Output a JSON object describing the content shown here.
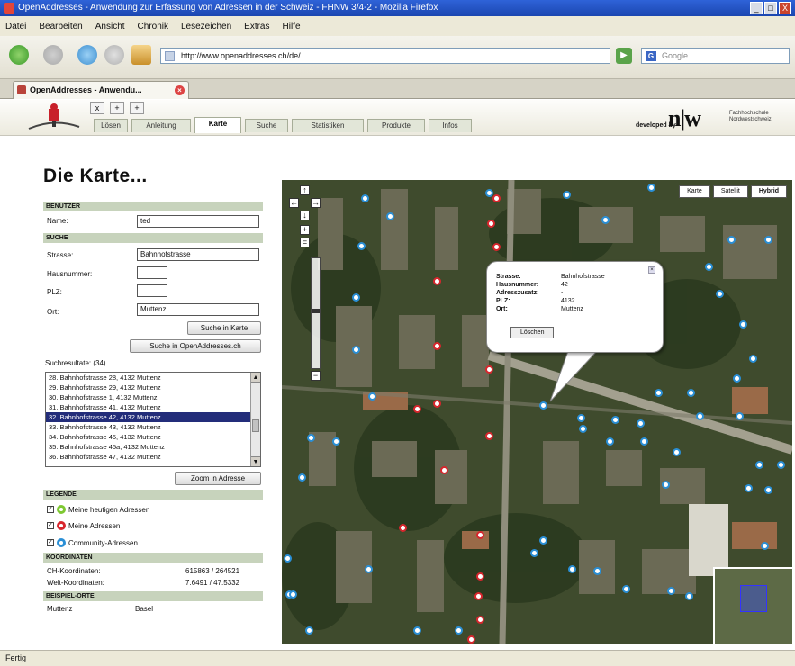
{
  "window": {
    "title": "OpenAddresses - Anwendung zur Erfassung von Adressen in der Schweiz - FHNW 3/4-2 - Mozilla Firefox",
    "buttons": [
      "_",
      "□",
      "X"
    ]
  },
  "menu": [
    "Datei",
    "Bearbeiten",
    "Ansicht",
    "Chronik",
    "Lesezeichen",
    "Extras",
    "Hilfe"
  ],
  "toolbar": {
    "url": "http://www.openaddresses.ch/de/",
    "search_placeholder": "Google"
  },
  "browser_tab": {
    "label": "OpenAddresses - Anwendu..."
  },
  "site": {
    "small_buttons": [
      "x",
      "+",
      "+"
    ],
    "tabs": [
      "Lösen",
      "Anleitung",
      "Karte",
      "Suche",
      "Statistiken",
      "Produkte",
      "Infos"
    ],
    "active_tab": "Karte",
    "developed_by": "developed by",
    "org_logo": "n|w",
    "org_name": "Fachhochschule Nordwestschweiz"
  },
  "page": {
    "title": "Die Karte...",
    "benutzer": {
      "header": "BENUTZER",
      "name_label": "Name:",
      "name_value": "ted"
    },
    "suche": {
      "header": "SUCHE",
      "strasse_label": "Strasse:",
      "strasse_value": "Bahnhofstrasse",
      "hausnummer_label": "Hausnummer:",
      "hausnummer_value": "",
      "plz_label": "PLZ:",
      "plz_value": "",
      "ort_label": "Ort:",
      "ort_value": "Muttenz",
      "btn_karte": "Suche in Karte",
      "btn_openaddresses": "Suche in OpenAddresses.ch"
    },
    "results": {
      "label": "Suchresultate: (34)",
      "rows": [
        "28. Bahnhofstrasse 28, 4132 Muttenz",
        "29. Bahnhofstrasse 29, 4132 Muttenz",
        "30. Bahnhofstrasse 1, 4132 Muttenz",
        "31. Bahnhofstrasse 41, 4132 Muttenz",
        "32. Bahnhofstrasse 42, 4132 Muttenz",
        "33. Bahnhofstrasse 43, 4132 Muttenz",
        "34. Bahnhofstrasse 45, 4132 Muttenz",
        "35. Bahnhofstrasse 45a, 4132 Muttenz",
        "36. Bahnhofstrasse 47, 4132 Muttenz"
      ],
      "selected_index": 4,
      "btn_zoom": "Zoom in Adresse"
    },
    "legende": {
      "header": "LEGENDE",
      "items": [
        {
          "label": "Meine heutigen Adressen",
          "color": "#7ec832"
        },
        {
          "label": "Meine Adressen",
          "color": "#d8262d"
        },
        {
          "label": "Community-Adressen",
          "color": "#2a8fd6"
        }
      ]
    },
    "koordinaten": {
      "header": "KOORDINATEN",
      "ch_label": "CH-Koordinaten:",
      "ch_value": "615863 / 264521",
      "welt_label": "Welt-Koordinaten:",
      "welt_value": "7.6491 / 47.5332"
    },
    "beispiel": {
      "header": "BEISPIEL-ORTE",
      "items": [
        "Muttenz",
        "Basel"
      ]
    }
  },
  "map": {
    "types": [
      "Karte",
      "Satellit",
      "Hybrid"
    ],
    "active_type": "Hybrid",
    "popup": {
      "rows": [
        {
          "k": "Strasse:",
          "v": "Bahnhofstrasse"
        },
        {
          "k": "Hausnummer:",
          "v": "42"
        },
        {
          "k": "Adresszusatz:",
          "v": "-"
        },
        {
          "k": "PLZ:",
          "v": "4132"
        },
        {
          "k": "Ort:",
          "v": "Muttenz"
        }
      ],
      "button": "Löschen"
    },
    "marker_colors": {
      "community": "#2a8fd6",
      "mine": "#d8262d"
    }
  },
  "status": "Fertig"
}
